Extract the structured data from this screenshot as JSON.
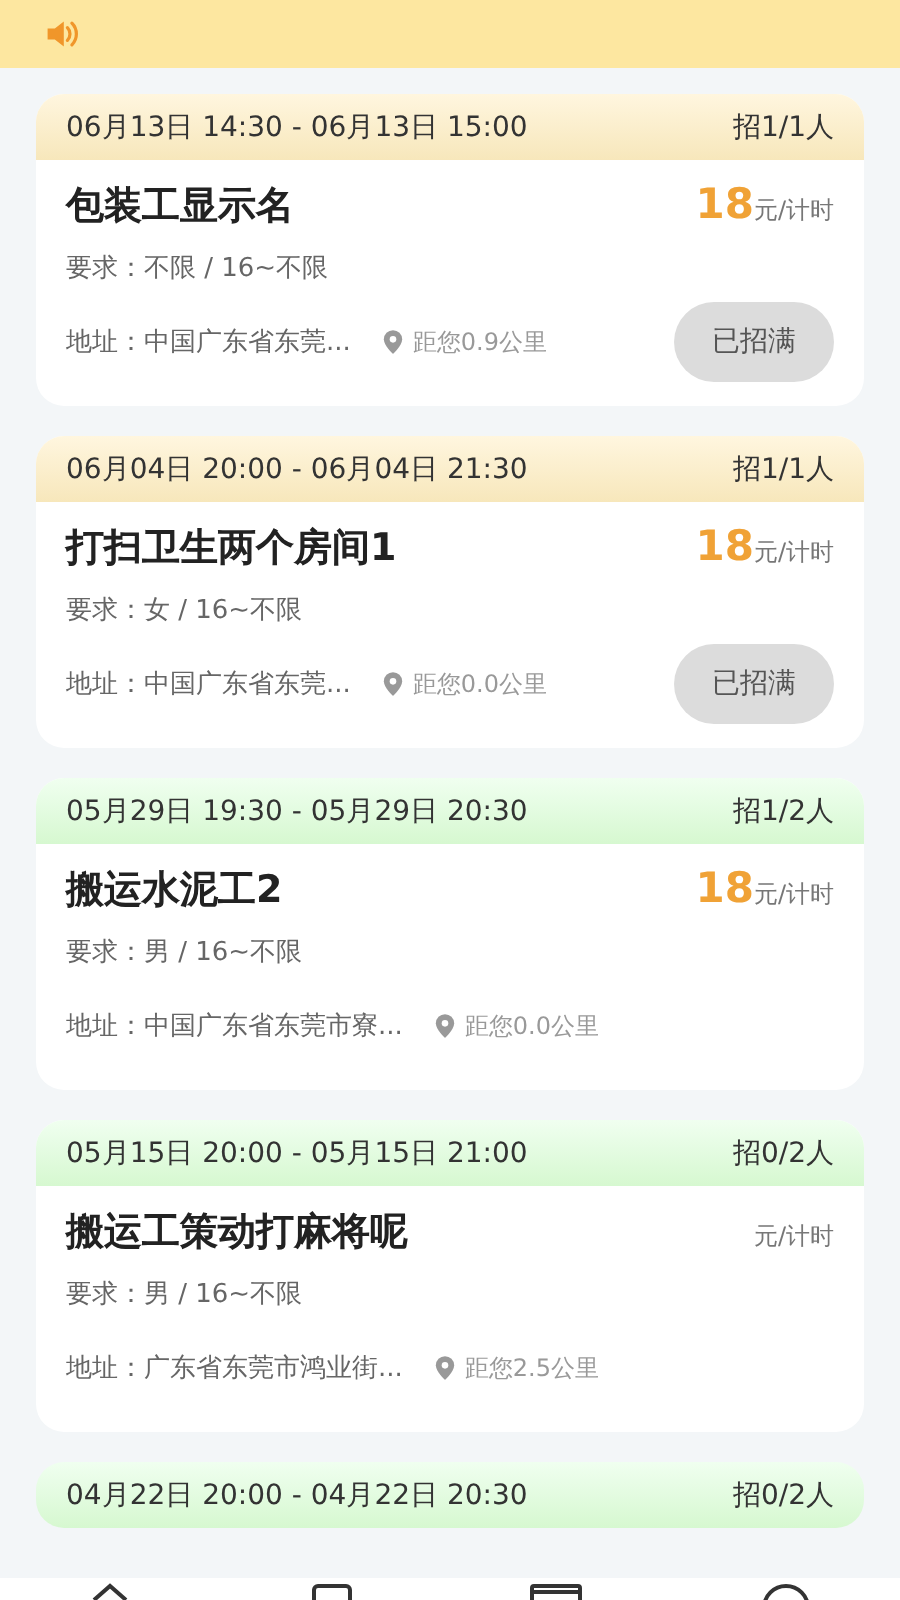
{
  "jobs": [
    {
      "full": true,
      "time": "06月13日 14:30 - 06月13日 15:00",
      "quota": "招1/1人",
      "title": "包装工显示名",
      "price": "18",
      "unit": "元/计时",
      "requirement": "要求：不限  / 16~不限",
      "address": "地址：中国广东省东莞...",
      "distance": "距您0.9公里",
      "button": "已招满"
    },
    {
      "full": true,
      "time": "06月04日 20:00 - 06月04日 21:30",
      "quota": "招1/1人",
      "title": "打扫卫生两个房间1",
      "price": "18",
      "unit": "元/计时",
      "requirement": "要求：女  / 16~不限",
      "address": "地址：中国广东省东莞...",
      "distance": "距您0.0公里",
      "button": "已招满"
    },
    {
      "full": false,
      "time": "05月29日 19:30 - 05月29日 20:30",
      "quota": "招1/2人",
      "title": "搬运水泥工2",
      "price": "18",
      "unit": "元/计时",
      "requirement": "要求：男  / 16~不限",
      "address": "地址：中国广东省东莞市寮...",
      "distance": "距您0.0公里"
    },
    {
      "full": false,
      "time": "05月15日 20:00 - 05月15日 21:00",
      "quota": "招0/2人",
      "title": "搬运工策动打麻将呢",
      "unit": "元/计时",
      "requirement": "要求：男  / 16~不限",
      "address": "地址：广东省东莞市鸿业街...",
      "distance": "距您2.5公里"
    },
    {
      "full": false,
      "time": "04月22日 20:00 - 04月22日 20:30",
      "quota": "招0/2人"
    }
  ]
}
